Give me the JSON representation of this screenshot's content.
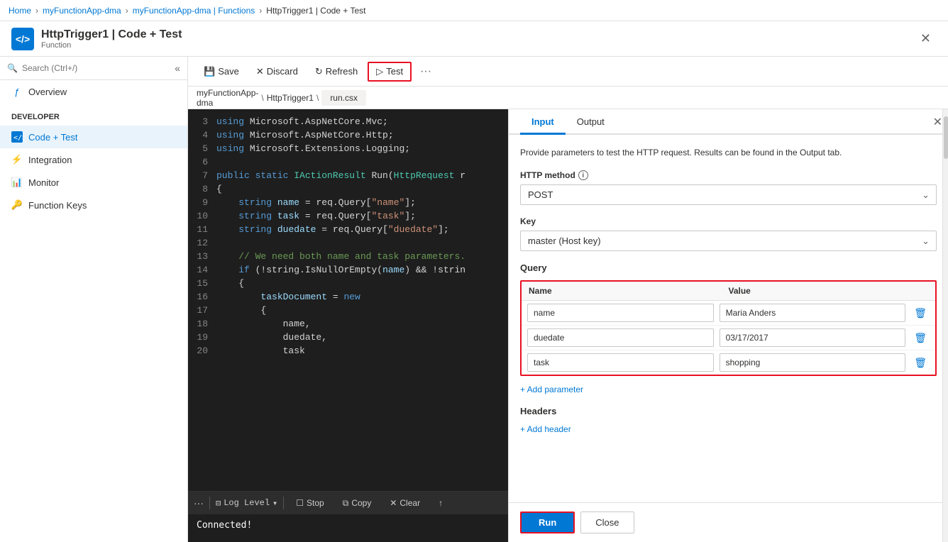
{
  "breadcrumbs": {
    "home": "Home",
    "app1": "myFunctionApp-dma",
    "app2": "myFunctionApp-dma | Functions",
    "current": "HttpTrigger1 | Code + Test"
  },
  "titlebar": {
    "icon": "</>",
    "title": "HttpTrigger1 | Code + Test",
    "subtitle": "Function"
  },
  "sidebar": {
    "search_placeholder": "Search (Ctrl+/)",
    "overview_label": "Overview",
    "developer_section": "Developer",
    "items": [
      {
        "id": "code-test",
        "label": "Code + Test",
        "active": true
      },
      {
        "id": "integration",
        "label": "Integration",
        "active": false
      },
      {
        "id": "monitor",
        "label": "Monitor",
        "active": false
      },
      {
        "id": "function-keys",
        "label": "Function Keys",
        "active": false
      }
    ]
  },
  "toolbar": {
    "save_label": "Save",
    "discard_label": "Discard",
    "refresh_label": "Refresh",
    "test_label": "Test"
  },
  "breadcrumb_bar": {
    "app": "myFunctionApp-\ndma",
    "sep1": "\\",
    "file": "HttpTrigger1",
    "sep2": "\\",
    "filename": "run.csx"
  },
  "code": {
    "lines": [
      {
        "num": "3",
        "code": "using Microsoft.AspNetCore.Mvc;",
        "type": "using"
      },
      {
        "num": "4",
        "code": "using Microsoft.AspNetCore.Http;",
        "type": "using"
      },
      {
        "num": "5",
        "code": "using Microsoft.Extensions.Logging;",
        "type": "using"
      },
      {
        "num": "6",
        "code": "",
        "type": "empty"
      },
      {
        "num": "7",
        "code": "public static IActionResult Run(HttpRequest r",
        "type": "method"
      },
      {
        "num": "8",
        "code": "{",
        "type": "brace"
      },
      {
        "num": "9",
        "code": "    string name = req.Query[\"name\"];",
        "type": "var"
      },
      {
        "num": "10",
        "code": "    string task = req.Query[\"task\"];",
        "type": "var"
      },
      {
        "num": "11",
        "code": "    string duedate = req.Query[\"duedate\"];",
        "type": "var"
      },
      {
        "num": "12",
        "code": "",
        "type": "empty"
      },
      {
        "num": "13",
        "code": "    // We need both name and task parameters.",
        "type": "comment"
      },
      {
        "num": "14",
        "code": "    if (!string.IsNullOrEmpty(name) && !strin",
        "type": "if"
      },
      {
        "num": "15",
        "code": "    {",
        "type": "brace"
      },
      {
        "num": "16",
        "code": "        taskDocument = new",
        "type": "code"
      },
      {
        "num": "17",
        "code": "        {",
        "type": "brace"
      },
      {
        "num": "18",
        "code": "            name,",
        "type": "code"
      },
      {
        "num": "19",
        "code": "            duedate,",
        "type": "code"
      },
      {
        "num": "20",
        "code": "            task",
        "type": "code"
      }
    ]
  },
  "log": {
    "filter_label": "Log Level",
    "stop_label": "Stop",
    "copy_label": "Copy",
    "clear_label": "Clear",
    "connected_message": "Connected!"
  },
  "right_panel": {
    "input_tab": "Input",
    "output_tab": "Output",
    "description": "Provide parameters to test the HTTP request. Results can be found in the Output tab.",
    "http_method_label": "HTTP method",
    "http_method_info": "i",
    "http_method_value": "POST",
    "key_label": "Key",
    "key_value": "master (Host key)",
    "query_section": "Query",
    "query_name_col": "Name",
    "query_value_col": "Value",
    "query_rows": [
      {
        "name": "name",
        "value": "Maria Anders"
      },
      {
        "name": "duedate",
        "value": "03/17/2017"
      },
      {
        "name": "task",
        "value": "shopping"
      }
    ],
    "add_param_label": "+ Add parameter",
    "headers_section": "Headers",
    "add_header_label": "+ Add header",
    "run_btn": "Run",
    "close_btn": "Close"
  }
}
